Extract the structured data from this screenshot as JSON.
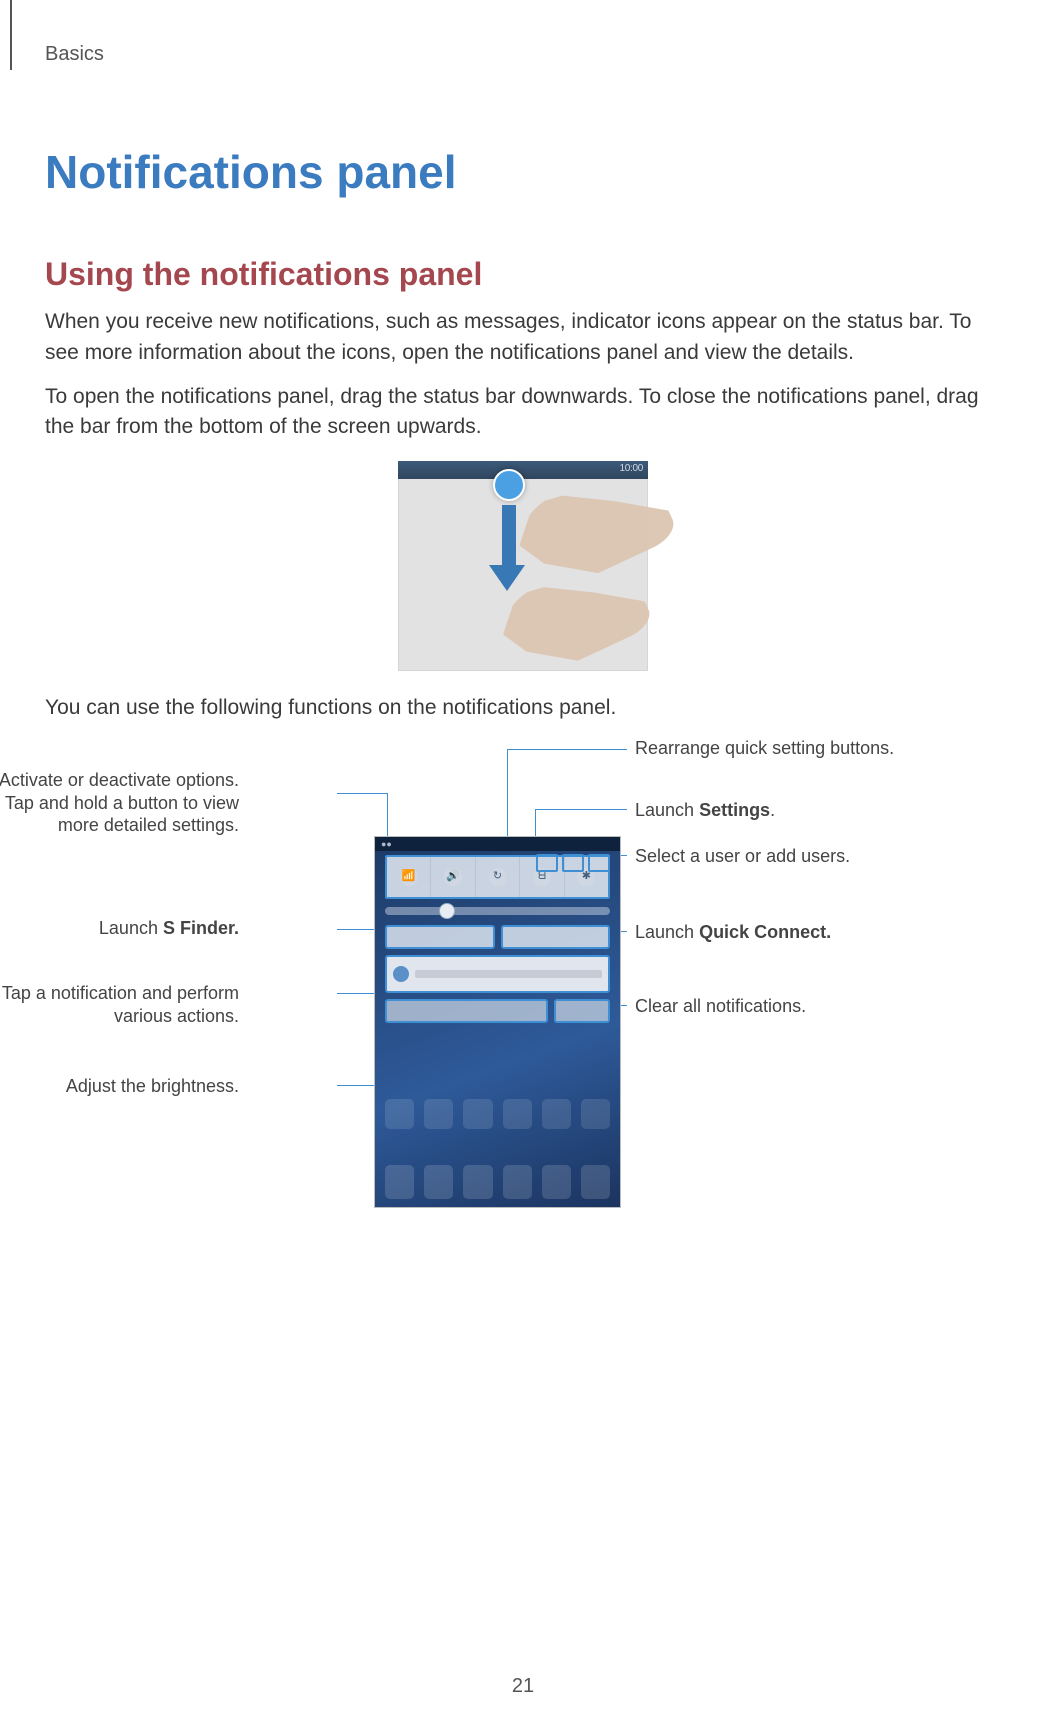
{
  "chapter": "Basics",
  "title": "Notifications panel",
  "section": "Using the notifications panel",
  "para1": "When you receive new notifications, such as messages, indicator icons appear on the status bar. To see more information about the icons, open the notifications panel and view the details.",
  "para2": "To open the notifications panel, drag the status bar downwards. To close the notifications panel, drag the bar from the bottom of the screen upwards.",
  "para3": "You can use the following functions on the notifications panel.",
  "figure1": {
    "time": "10:00"
  },
  "callouts": {
    "left": {
      "quickToggle": "Activate or deactivate options. Tap and hold a button to view more detailed settings.",
      "sfinder_pre": "Launch ",
      "sfinder_bold": "S Finder.",
      "notifAction": "Tap a notification and perform various actions.",
      "brightness": "Adjust the brightness."
    },
    "right": {
      "rearrange": "Rearrange quick setting buttons.",
      "settings_pre": "Launch ",
      "settings_bold": "Settings",
      "settings_post": ".",
      "users": "Select a user or add users.",
      "quickconnect_pre": "Launch ",
      "quickconnect_bold": "Quick Connect.",
      "clear": "Clear all notifications."
    }
  },
  "pageNumber": "21"
}
